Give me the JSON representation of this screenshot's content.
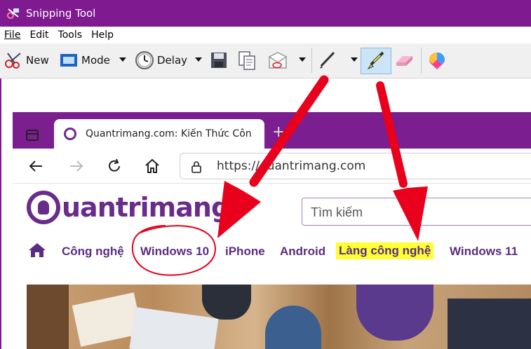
{
  "window": {
    "title": "Snipping Tool"
  },
  "menubar": {
    "items": [
      {
        "label": "File"
      },
      {
        "label": "Edit"
      },
      {
        "label": "Tools"
      },
      {
        "label": "Help"
      }
    ]
  },
  "toolbar": {
    "new_label": "New",
    "mode_label": "Mode",
    "delay_label": "Delay"
  },
  "browser": {
    "tab_title": "Quantrimang.com: Kiến Thức Côn",
    "tab_close": "×",
    "new_tab": "+",
    "url": "https://quantrimang.com"
  },
  "site": {
    "logo_text": "uantrimang",
    "search_placeholder": "Tìm kiếm",
    "nav": [
      {
        "label": "Công nghệ"
      },
      {
        "label": "Windows 10"
      },
      {
        "label": "iPhone"
      },
      {
        "label": "Android"
      },
      {
        "label": "Làng công nghệ"
      },
      {
        "label": "Windows 11"
      }
    ]
  },
  "colors": {
    "titlebar": "#7f1a91",
    "browser_chrome": "#7b1e8f",
    "brand_purple": "#6a2c8a",
    "nav_text": "#5b2c82",
    "highlight": "#ffff33",
    "annotation_red": "#e8001c"
  },
  "icons": {
    "app": "snipping-tool-icon",
    "new": "scissors-icon",
    "mode": "rectangle-snip-icon",
    "delay": "clock-icon",
    "save": "save-icon",
    "copy": "copy-icon",
    "send": "envelope-icon",
    "pen": "pen-icon",
    "highlighter": "highlighter-icon",
    "eraser": "eraser-icon",
    "paint3d": "paint-3d-icon"
  }
}
